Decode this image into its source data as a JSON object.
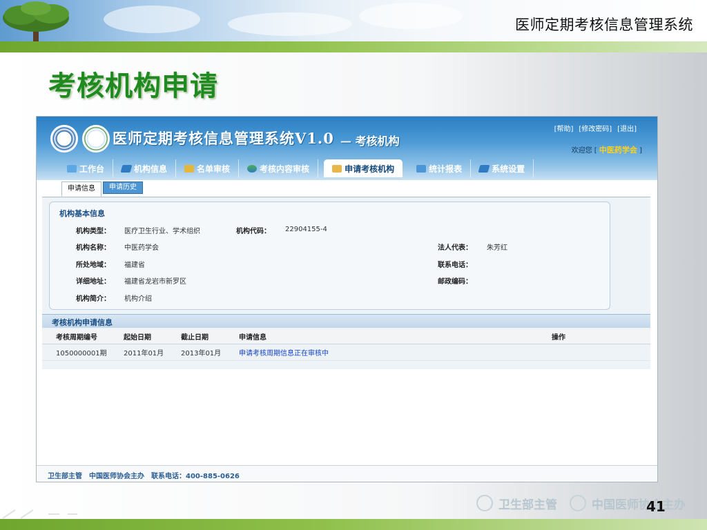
{
  "slide": {
    "header_title": "医师定期考核信息管理系统",
    "section_title": "考核机构申请",
    "page_number": "41",
    "watermark": [
      "卫生部主管",
      "中国医师协会主办"
    ]
  },
  "app": {
    "title": "医师定期考核信息管理系统V1.0",
    "subtitle": "— 考核机构",
    "top_links": [
      "[帮助]",
      "[修改密码]",
      "[退出]"
    ],
    "welcome_prefix": "欢迎您 [",
    "welcome_org": "中医药学会",
    "welcome_suffix": "]",
    "nav": [
      {
        "label": "工作台",
        "active": false
      },
      {
        "label": "机构信息",
        "active": false
      },
      {
        "label": "名单审核",
        "active": false
      },
      {
        "label": "考核内容审核",
        "active": false
      },
      {
        "label": "申请考核机构",
        "active": true
      },
      {
        "label": "统计报表",
        "active": false
      },
      {
        "label": "系统设置",
        "active": false
      }
    ],
    "subtabs": [
      {
        "label": "申请信息",
        "active": true
      },
      {
        "label": "申请历史",
        "active": false
      }
    ],
    "basic_info": {
      "title": "机构基本信息",
      "type_label": "机构类型：",
      "type_value": "医疗卫生行业、学术组织",
      "code_label": "机构代码：",
      "code_value": "22904155-4",
      "name_label": "机构名称：",
      "name_value": "中医药学会",
      "legal_label": "法人代表：",
      "legal_value": "朱芳红",
      "region_label": "所处地域：",
      "region_value": "福建省",
      "phone_label": "联系电话：",
      "phone_value": "",
      "address_label": "详细地址：",
      "address_value": "福建省龙岩市新罗区",
      "postcode_label": "邮政编码：",
      "postcode_value": "",
      "intro_label": "机构简介：",
      "intro_value": "机构介绍"
    },
    "apply_info": {
      "title": "考核机构申请信息",
      "columns": [
        "考核周期编号",
        "起始日期",
        "截止日期",
        "申请信息",
        "操作"
      ],
      "rows": [
        [
          "1050000001期",
          "2011年01月",
          "2013年01月",
          "申请考核周期信息正在审核中",
          ""
        ]
      ]
    },
    "footer": "卫生部主管　中国医师协会主办　联系电话：400-885-0626"
  }
}
